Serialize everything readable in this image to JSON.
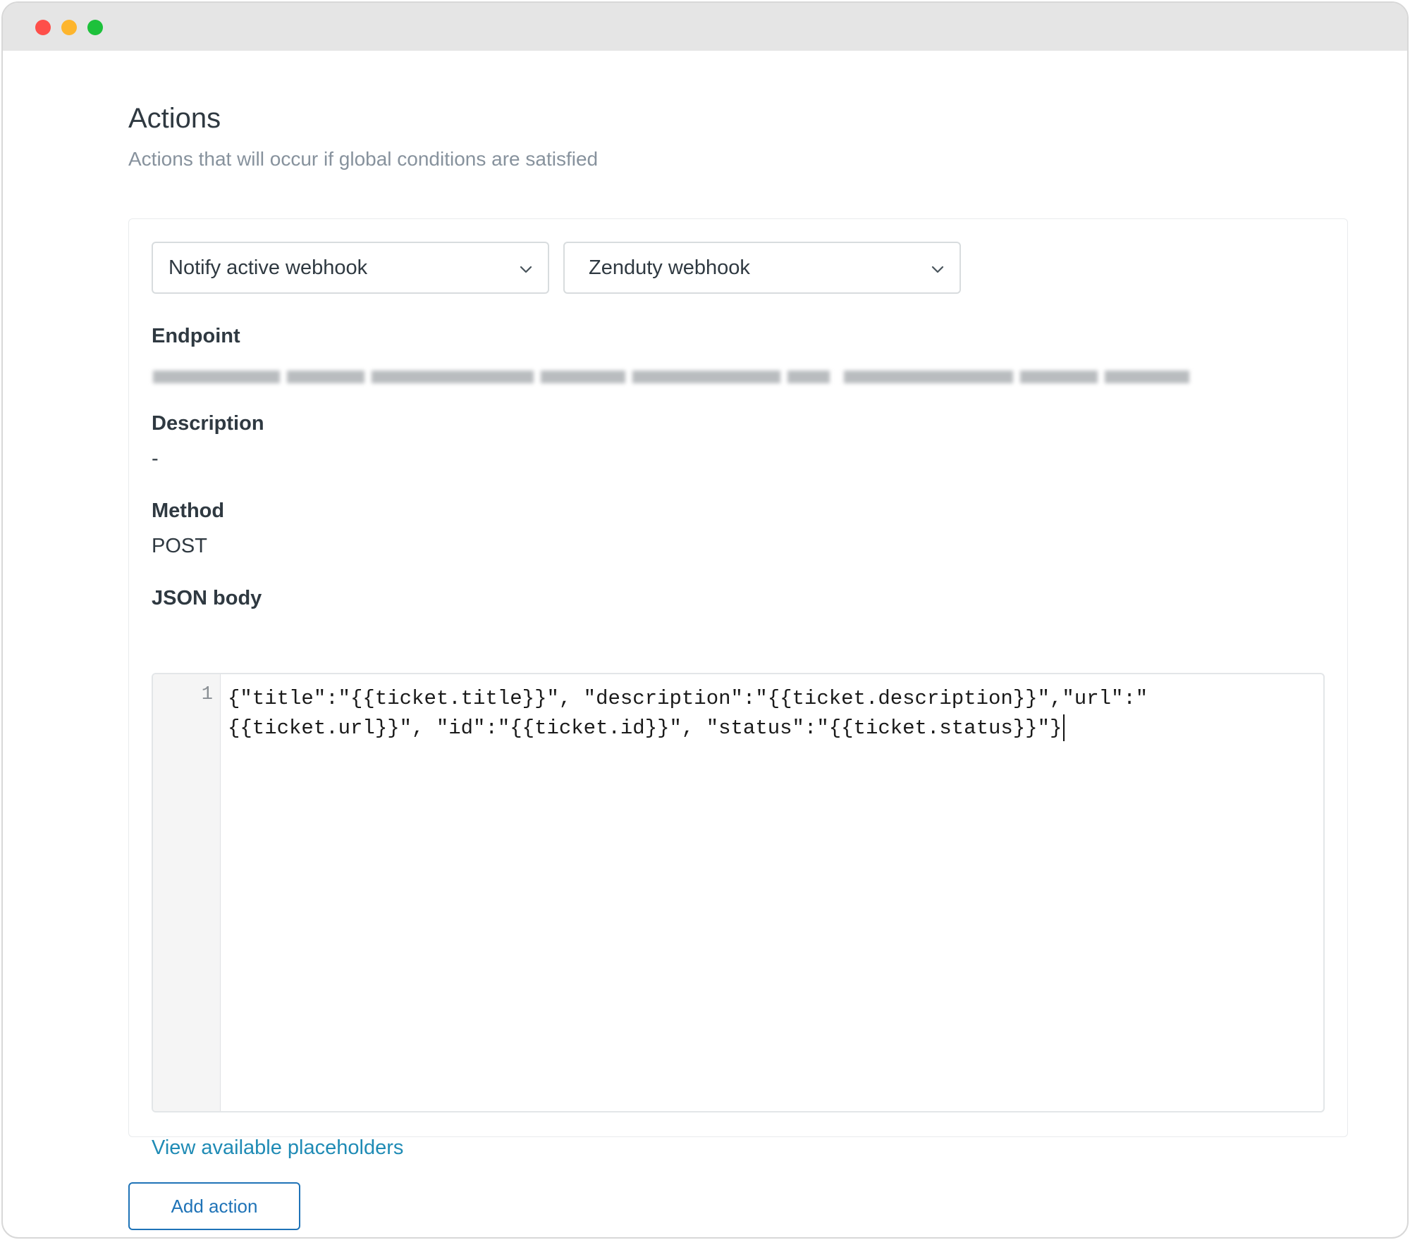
{
  "section": {
    "title": "Actions",
    "subtitle": "Actions that will occur if global conditions are satisfied"
  },
  "action": {
    "type_select": {
      "value": "Notify active webhook",
      "icon": "chevron-down-icon"
    },
    "target_select": {
      "value": "Zenduty webhook",
      "icon": "chevron-down-icon"
    },
    "endpoint_label": "Endpoint",
    "description_label": "Description",
    "description_value": "-",
    "method_label": "Method",
    "method_value": "POST",
    "json_label": "JSON body",
    "editor": {
      "line_number": "1",
      "line1": "{\"title\":\"{{ticket.title}}\", \"description\":\"{{ticket.description}}\",\"url\":\"",
      "line2": "{{ticket.url}}\", \"id\":\"{{ticket.id}}\", \"status\":\"{{ticket.status}}\"}"
    },
    "placeholders_link": "View available placeholders"
  },
  "add_action_label": "Add action",
  "colors": {
    "link": "#1f8bb5",
    "primary": "#1f73b7",
    "text": "#2f3941",
    "muted": "#87929d"
  }
}
